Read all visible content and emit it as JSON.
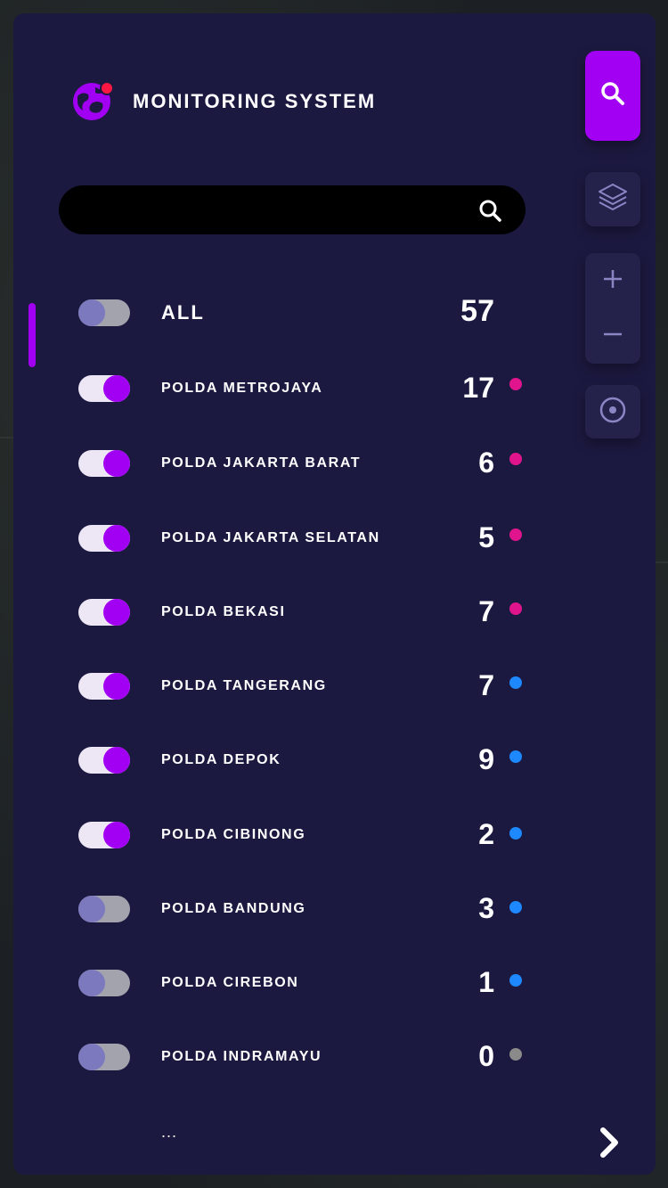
{
  "app": {
    "title": "MONITORING SYSTEM"
  },
  "search": {
    "value": "",
    "placeholder": ""
  },
  "list": {
    "all": {
      "label": "ALL",
      "count": "57",
      "enabled": false
    },
    "items": [
      {
        "label": "POLDA METROJAYA",
        "count": "17",
        "enabled": true,
        "status_color": "#e0148c"
      },
      {
        "label": "POLDA JAKARTA BARAT",
        "count": "6",
        "enabled": true,
        "status_color": "#e0148c"
      },
      {
        "label": "POLDA JAKARTA SELATAN",
        "count": "5",
        "enabled": true,
        "status_color": "#e0148c"
      },
      {
        "label": "POLDA BEKASI",
        "count": "7",
        "enabled": true,
        "status_color": "#e0148c"
      },
      {
        "label": "POLDA TANGERANG",
        "count": "7",
        "enabled": true,
        "status_color": "#1e88ff"
      },
      {
        "label": "POLDA DEPOK",
        "count": "9",
        "enabled": true,
        "status_color": "#1e88ff"
      },
      {
        "label": "POLDA CIBINONG",
        "count": "2",
        "enabled": true,
        "status_color": "#1e88ff"
      },
      {
        "label": "POLDA BANDUNG",
        "count": "3",
        "enabled": false,
        "status_color": "#1e88ff"
      },
      {
        "label": "POLDA CIREBON",
        "count": "1",
        "enabled": false,
        "status_color": "#1e88ff"
      },
      {
        "label": "POLDA INDRAMAYU",
        "count": "0",
        "enabled": false,
        "status_color": "#8a8a8a"
      }
    ],
    "more": "..."
  },
  "icons": {
    "brand": "globe-icon",
    "search": "search-icon",
    "layers": "layers-icon",
    "zoom_in": "plus-icon",
    "zoom_out": "minus-icon",
    "locate": "target-icon",
    "next": "chevron-right-icon"
  },
  "colors": {
    "panel": "#1c1940",
    "accent": "#a100f2",
    "notification": "#ff1744",
    "toggle_off_knob": "#7c79bf",
    "toggle_on_track": "#ece6f5"
  }
}
